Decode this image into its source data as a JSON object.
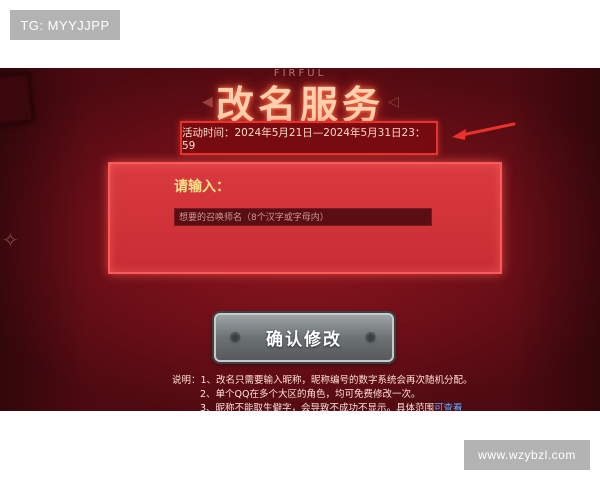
{
  "watermarks": {
    "top_left": "TG: MYYJJPP",
    "bottom_right": "www.wzybzl.com"
  },
  "header": {
    "subtitle": "FIRFUL",
    "title": "改名服务"
  },
  "event": {
    "date_text": "活动时间：2024年5月21日—2024年5月31日23：59"
  },
  "form": {
    "label": "请输入：",
    "placeholder": "想要的召唤师名（8个汉字或字母内）"
  },
  "confirm_button": {
    "label": "确认修改"
  },
  "notes": {
    "prefix": "说明：",
    "line1": "1、改名只需要输入昵称，昵称编号的数字系统会再次随机分配。",
    "line2": "2、单个QQ在多个大区的角色，均可免费修改一次。",
    "line3": "3、昵称不能取生僻字，会导致不成功不显示。具体范围",
    "line3_link": "可查看"
  },
  "colors": {
    "background": "#6e0f18",
    "accent_red": "#e8322a",
    "input_panel": "#d93a3f",
    "label_yellow": "#ffe28a",
    "link_blue": "#66a8ff",
    "annotation_arrow": "#e8322a"
  },
  "icons": [
    "speaker-icon",
    "eye-icon",
    "arrow-annotation"
  ]
}
